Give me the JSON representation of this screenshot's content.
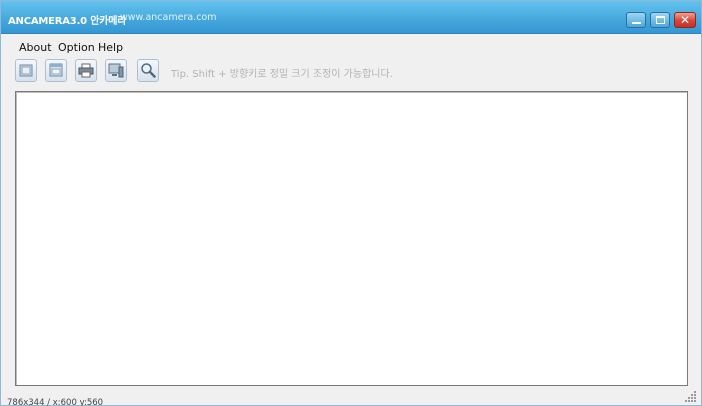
{
  "window": {
    "title": "ANCAMERA3.0 안카메라",
    "url": "www.ancamera.com"
  },
  "titlebar_buttons": {
    "minimize_icon": "minimize-icon",
    "maximize_icon": "maximize-icon",
    "close_icon": "close-icon",
    "close_glyph": "✕"
  },
  "menu": {
    "items": [
      {
        "label": "About"
      },
      {
        "label": "Option"
      },
      {
        "label": "Help"
      }
    ]
  },
  "toolbar": {
    "buttons": [
      {
        "icon": "square-frame-icon"
      },
      {
        "icon": "window-frame-icon"
      },
      {
        "icon": "printer-icon"
      },
      {
        "icon": "monitor-icon"
      },
      {
        "icon": "magnifier-icon"
      }
    ],
    "tip": "Tip. Shift + 방향키로 정밀 크기 조정이 가능합니다."
  },
  "status": {
    "text": "786x344 / x:600 y:560"
  },
  "colors": {
    "titlebar": "#47a8dd",
    "close_button": "#d8453a",
    "background": "#f0f0f0"
  }
}
